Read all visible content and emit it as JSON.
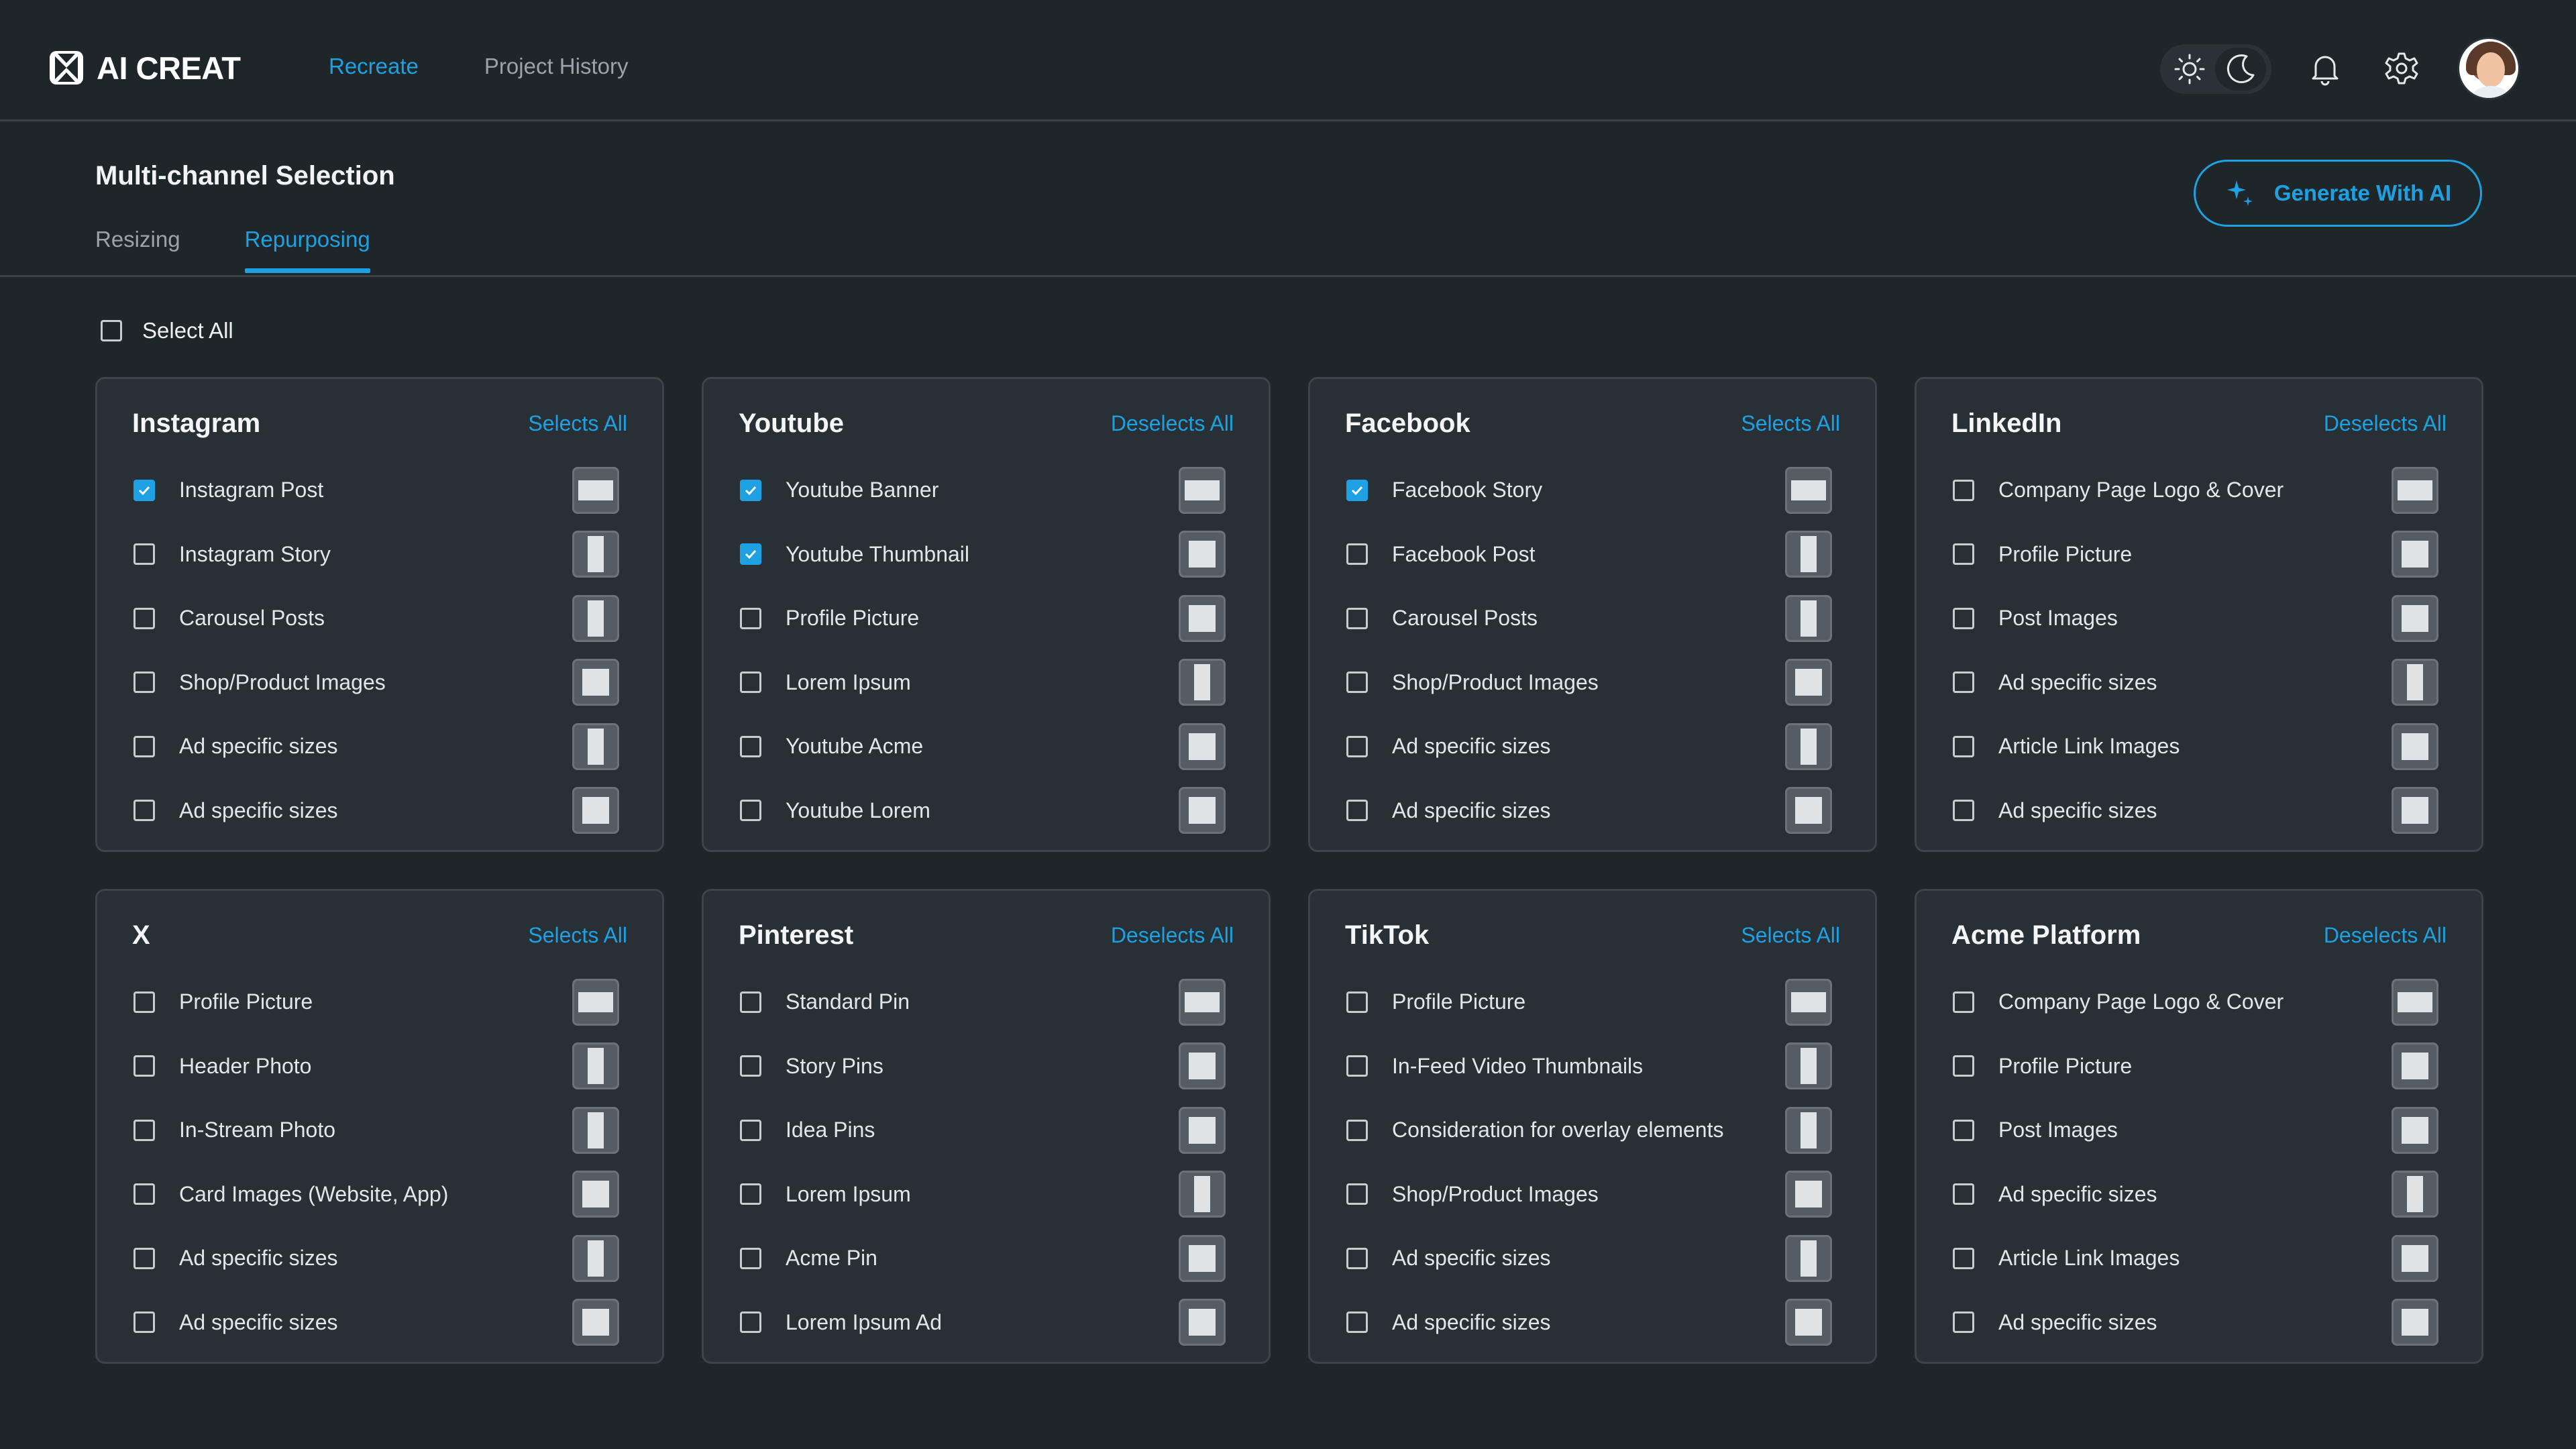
{
  "app": {
    "name": "AI CREAT"
  },
  "nav": [
    {
      "label": "Recreate",
      "active": true
    },
    {
      "label": "Project History",
      "active": false
    }
  ],
  "header_icons": [
    "sun-icon",
    "moon-icon",
    "bell-icon",
    "gear-icon",
    "avatar"
  ],
  "page": {
    "title": "Multi-channel Selection",
    "tabs": [
      {
        "label": "Resizing",
        "active": false
      },
      {
        "label": "Repurposing",
        "active": true
      }
    ],
    "generate_label": "Generate With AI",
    "select_all_label": "Select All",
    "select_all_checked": false
  },
  "colors": {
    "accent": "#1da1e2",
    "background": "#1f262a",
    "card": "#283035"
  },
  "cards": [
    {
      "title": "Instagram",
      "action": "Selects All",
      "items": [
        {
          "label": "Instagram Post",
          "checked": true,
          "ratio": "landscape"
        },
        {
          "label": "Instagram Story",
          "checked": false,
          "ratio": "portrait"
        },
        {
          "label": "Carousel Posts",
          "checked": false,
          "ratio": "portrait"
        },
        {
          "label": "Shop/Product Images",
          "checked": false,
          "ratio": "square"
        },
        {
          "label": "Ad specific sizes",
          "checked": false,
          "ratio": "portrait"
        },
        {
          "label": "Ad specific sizes",
          "checked": false,
          "ratio": "square"
        }
      ]
    },
    {
      "title": "Youtube",
      "action": "Deselects All",
      "items": [
        {
          "label": "Youtube Banner",
          "checked": true,
          "ratio": "landscape"
        },
        {
          "label": "Youtube Thumbnail",
          "checked": true,
          "ratio": "square"
        },
        {
          "label": "Profile Picture",
          "checked": false,
          "ratio": "square"
        },
        {
          "label": "Lorem Ipsum",
          "checked": false,
          "ratio": "portrait"
        },
        {
          "label": "Youtube Acme",
          "checked": false,
          "ratio": "square"
        },
        {
          "label": "Youtube Lorem",
          "checked": false,
          "ratio": "square"
        }
      ]
    },
    {
      "title": "Facebook",
      "action": "Selects All",
      "items": [
        {
          "label": "Facebook Story",
          "checked": true,
          "ratio": "landscape"
        },
        {
          "label": "Facebook Post",
          "checked": false,
          "ratio": "portrait"
        },
        {
          "label": "Carousel Posts",
          "checked": false,
          "ratio": "portrait"
        },
        {
          "label": "Shop/Product Images",
          "checked": false,
          "ratio": "square"
        },
        {
          "label": "Ad specific sizes",
          "checked": false,
          "ratio": "portrait"
        },
        {
          "label": "Ad specific sizes",
          "checked": false,
          "ratio": "square"
        }
      ]
    },
    {
      "title": "LinkedIn",
      "action": "Deselects All",
      "items": [
        {
          "label": "Company Page Logo & Cover",
          "checked": false,
          "ratio": "landscape"
        },
        {
          "label": "Profile Picture",
          "checked": false,
          "ratio": "square"
        },
        {
          "label": "Post Images",
          "checked": false,
          "ratio": "square"
        },
        {
          "label": "Ad specific sizes",
          "checked": false,
          "ratio": "portrait"
        },
        {
          "label": "Article Link Images",
          "checked": false,
          "ratio": "square"
        },
        {
          "label": "Ad specific sizes",
          "checked": false,
          "ratio": "square"
        }
      ]
    },
    {
      "title": "X",
      "action": "Selects All",
      "items": [
        {
          "label": "Profile Picture",
          "checked": false,
          "ratio": "landscape"
        },
        {
          "label": "Header Photo",
          "checked": false,
          "ratio": "portrait"
        },
        {
          "label": "In-Stream Photo",
          "checked": false,
          "ratio": "portrait"
        },
        {
          "label": "Card Images (Website, App)",
          "checked": false,
          "ratio": "square"
        },
        {
          "label": "Ad specific sizes",
          "checked": false,
          "ratio": "portrait"
        },
        {
          "label": "Ad specific sizes",
          "checked": false,
          "ratio": "square"
        }
      ]
    },
    {
      "title": "Pinterest",
      "action": "Deselects All",
      "items": [
        {
          "label": "Standard Pin",
          "checked": false,
          "ratio": "landscape"
        },
        {
          "label": "Story Pins",
          "checked": false,
          "ratio": "square"
        },
        {
          "label": "Idea Pins",
          "checked": false,
          "ratio": "square"
        },
        {
          "label": "Lorem Ipsum",
          "checked": false,
          "ratio": "portrait"
        },
        {
          "label": "Acme Pin",
          "checked": false,
          "ratio": "square"
        },
        {
          "label": "Lorem Ipsum Ad",
          "checked": false,
          "ratio": "square"
        }
      ]
    },
    {
      "title": "TikTok",
      "action": "Selects All",
      "items": [
        {
          "label": "Profile Picture",
          "checked": false,
          "ratio": "landscape"
        },
        {
          "label": "In-Feed Video Thumbnails",
          "checked": false,
          "ratio": "portrait"
        },
        {
          "label": "Consideration for overlay elements",
          "checked": false,
          "ratio": "portrait"
        },
        {
          "label": "Shop/Product Images",
          "checked": false,
          "ratio": "square"
        },
        {
          "label": "Ad specific sizes",
          "checked": false,
          "ratio": "portrait"
        },
        {
          "label": "Ad specific sizes",
          "checked": false,
          "ratio": "square"
        }
      ]
    },
    {
      "title": "Acme Platform",
      "action": "Deselects All",
      "items": [
        {
          "label": "Company Page Logo & Cover",
          "checked": false,
          "ratio": "landscape"
        },
        {
          "label": "Profile Picture",
          "checked": false,
          "ratio": "square"
        },
        {
          "label": "Post Images",
          "checked": false,
          "ratio": "square"
        },
        {
          "label": "Ad specific sizes",
          "checked": false,
          "ratio": "portrait"
        },
        {
          "label": "Article Link Images",
          "checked": false,
          "ratio": "square"
        },
        {
          "label": "Ad specific sizes",
          "checked": false,
          "ratio": "square"
        }
      ]
    }
  ]
}
